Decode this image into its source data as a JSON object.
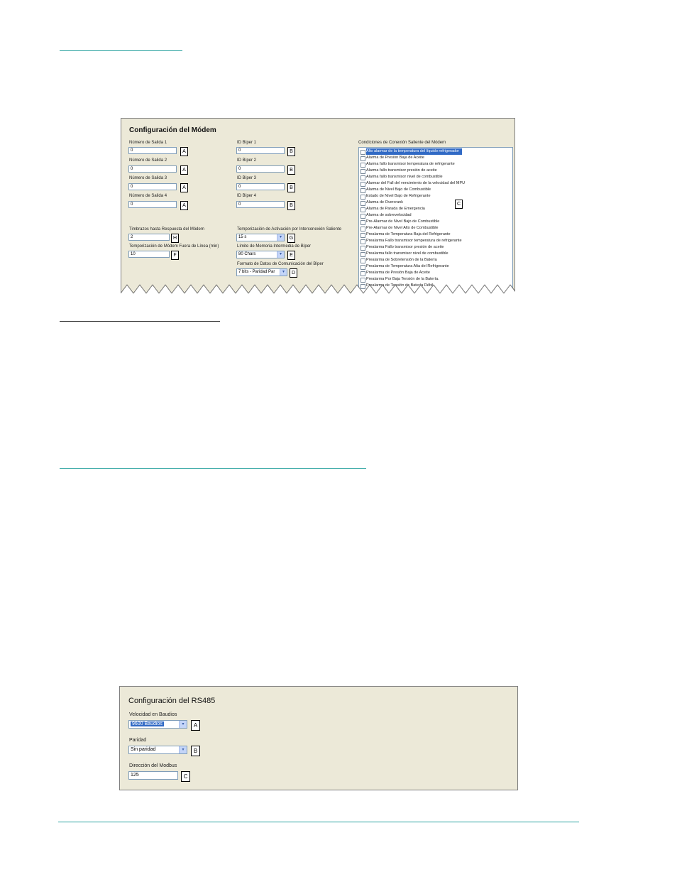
{
  "modem": {
    "title": "Configuración del Módem",
    "outputs": [
      {
        "label": "Número de Salida 1",
        "value": "0",
        "callout": "A"
      },
      {
        "label": "Número de Salida 2",
        "value": "0",
        "callout": "A"
      },
      {
        "label": "Número de Salida 3",
        "value": "0",
        "callout": "A"
      },
      {
        "label": "Número de Salida 4",
        "value": "0",
        "callout": "A"
      }
    ],
    "beepers": [
      {
        "label": "ID Bíper 1",
        "value": "0",
        "callout": "B"
      },
      {
        "label": "ID Bíper 2",
        "value": "0",
        "callout": "B"
      },
      {
        "label": "ID Bíper 3",
        "value": "0",
        "callout": "B"
      },
      {
        "label": "ID Bíper 4",
        "value": "0",
        "callout": "B"
      }
    ],
    "rings": {
      "label": "Timbrazos hasta Respuesta del Módem",
      "value": "2",
      "callout": "H"
    },
    "offline": {
      "label": "Temporización de Módem Fuera de Línea (min)",
      "value": "10",
      "callout": "F"
    },
    "activation": {
      "label": "Temporización de Activación por Interconexión Saliente",
      "value": "15 s",
      "callout": "G"
    },
    "buffer": {
      "label": "Límite de Memoria Intermedia de Bíper",
      "value": "80 Chars",
      "callout": "E"
    },
    "format": {
      "label": "Formato de Datos de Comunicación del Bíper",
      "value": "7 bits - Paridad Par",
      "callout": "D"
    },
    "conditions": {
      "label": "Condiciones de Conexión Saliente del Módem",
      "callout": "C",
      "items": [
        "Alto alarmar de la temperatura del líquido refrigerador",
        "Alarma de Presión Baja de Aceite",
        "Alarma fallo transmisor temperatura de refrigerante",
        "Alarma fallo transmisor presión de aceite",
        "Alarma fallo transmisor nivel de combustible",
        "Alarmar del Fall del vencimiento de la velocidad del MPU",
        "Alarma de Nivel Bajo de Combustible",
        "Estado de Nivel Bajo de Refrigerante",
        "Alarma de Overcrank",
        "Alarma de Parada de Emergencia",
        "Alarma de sobrevelocidad",
        "Pre-Alarmar de Nivel Bajo de Combustible",
        "Pre-Alarmar de Nivel Alto de Combustible",
        "Prealarma de Temperatura Baja del Refrigerante",
        "Prealarma Fallo transmisor temperatura de refrigerante",
        "Prealarma Fallo transmisor presión de aceite",
        "Prealarma fallo transmisor nivel de combustible",
        "Prealarma de Sobretensión de la Batería",
        "Prealarma de Temperatura Alta del Refrigerante",
        "Prealarma de Presión Baja de Aceite",
        "Prealarma Por Baja Tensión de la Batería.",
        "Prealarma de Tensión de Batería Débil"
      ]
    }
  },
  "rs485": {
    "title": "Configuración del RS485",
    "baud": {
      "label": "Velocidad en Baudios",
      "value": "9600 Baudios",
      "callout": "A"
    },
    "parity": {
      "label": "Paridad",
      "value": "Sin paridad",
      "callout": "B"
    },
    "modbus": {
      "label": "Dirección del Modbus",
      "value": "125",
      "callout": "C"
    }
  },
  "icons": {
    "dropdown": "▾"
  }
}
